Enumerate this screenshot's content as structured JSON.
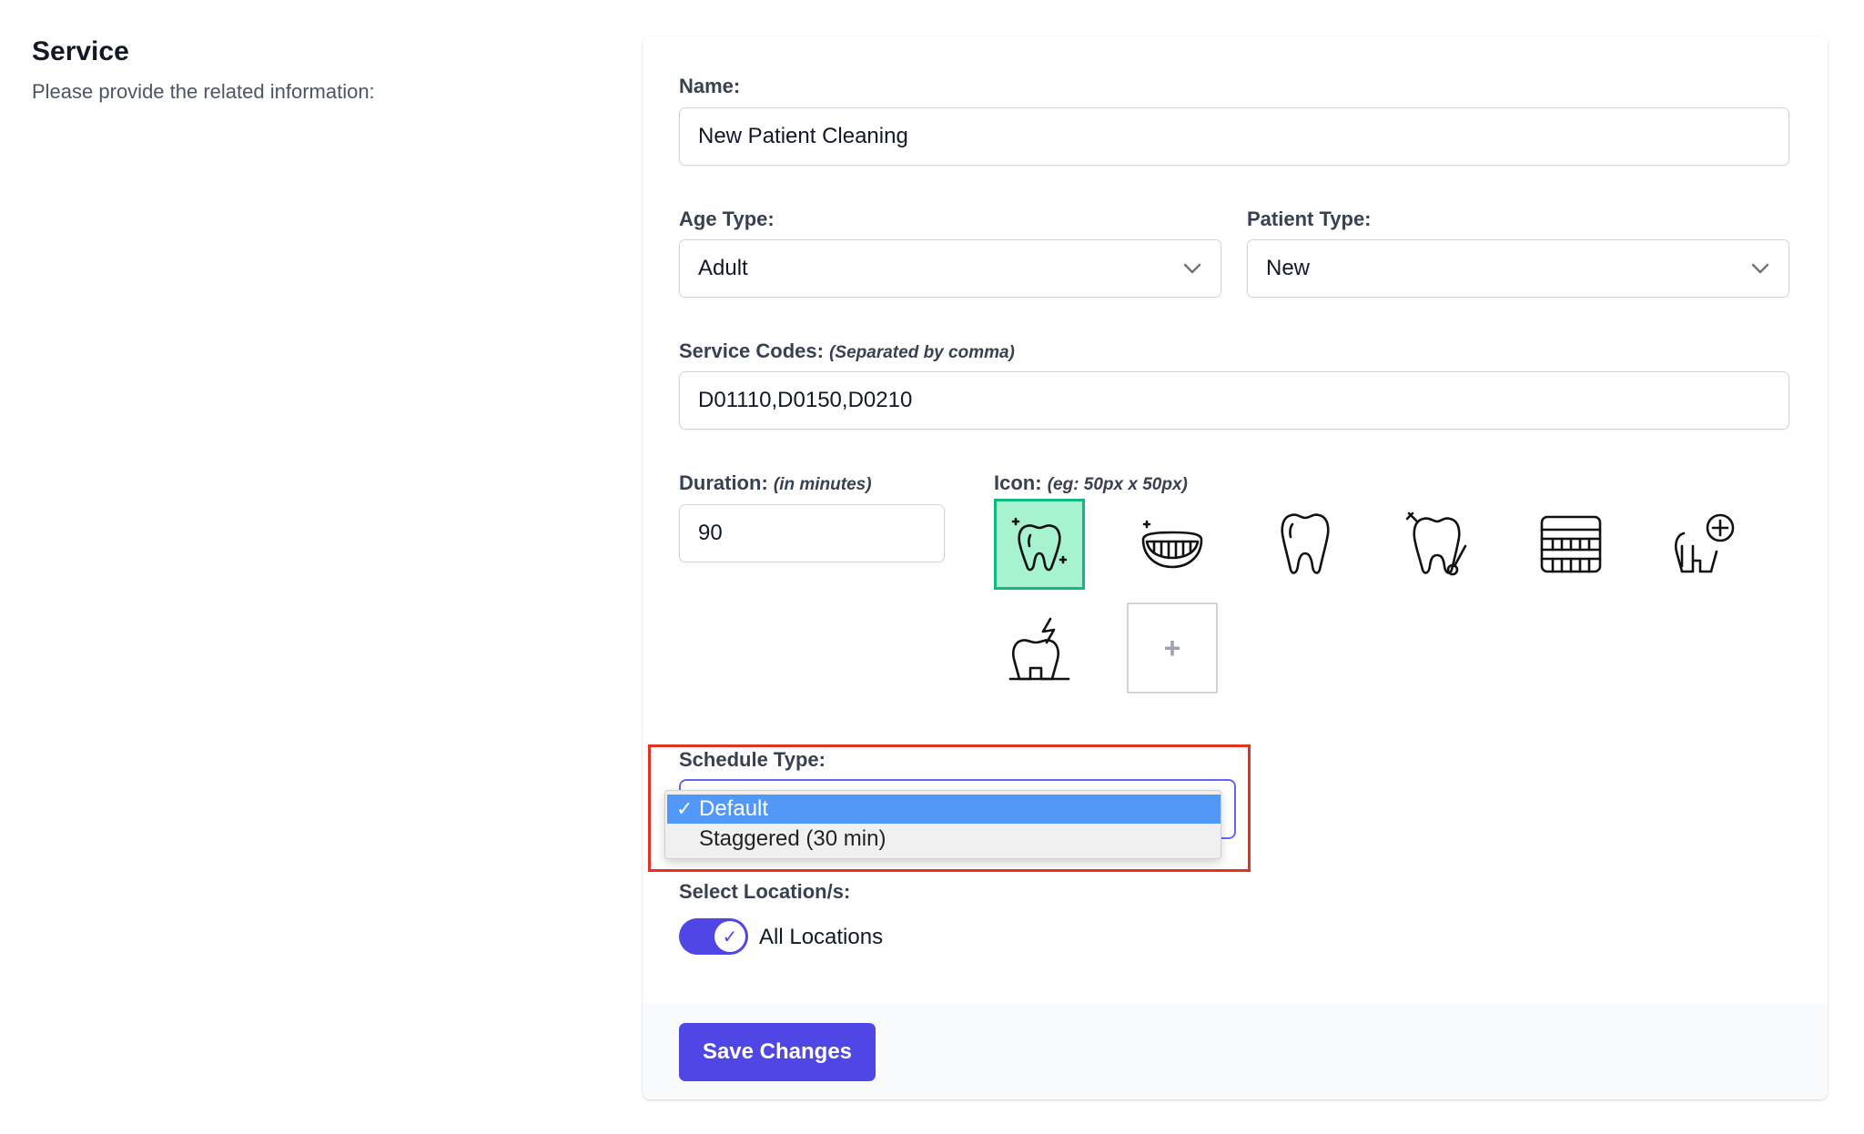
{
  "section": {
    "title": "Service",
    "description": "Please provide the related information:"
  },
  "form": {
    "name": {
      "label": "Name:",
      "value": "New Patient Cleaning"
    },
    "age_type": {
      "label": "Age Type:",
      "value": "Adult"
    },
    "patient_type": {
      "label": "Patient Type:",
      "value": "New"
    },
    "service_codes": {
      "label": "Service Codes:",
      "hint": "(Separated by comma)",
      "value": "D01110,D0150,D0210"
    },
    "duration": {
      "label": "Duration:",
      "hint": "(in minutes)",
      "value": "90"
    },
    "icon": {
      "label": "Icon:",
      "hint": "(eg: 50px x 50px)",
      "icons": [
        "tooth-sparkle-icon",
        "teeth-smile-icon",
        "tooth-icon",
        "tooth-brush-icon",
        "denture-icon",
        "tooth-plus-icon",
        "tooth-pain-icon"
      ],
      "selected_index": 0,
      "add_label": "+"
    },
    "schedule_type": {
      "label": "Schedule Type:",
      "options": [
        "Default",
        "Staggered (30 min)"
      ],
      "selected": "Default",
      "check_mark": "✓"
    },
    "locations": {
      "label": "Select Location/s:",
      "toggle_label": "All Locations",
      "toggle_on": true,
      "toggle_check": "✓"
    }
  },
  "footer": {
    "save_label": "Save Changes"
  },
  "colors": {
    "accent": "#4f46e5",
    "selected_icon_bg": "#a7f3d0",
    "selected_icon_border": "#10b981",
    "highlight": "#e5321f",
    "option_active": "#5299f7"
  }
}
